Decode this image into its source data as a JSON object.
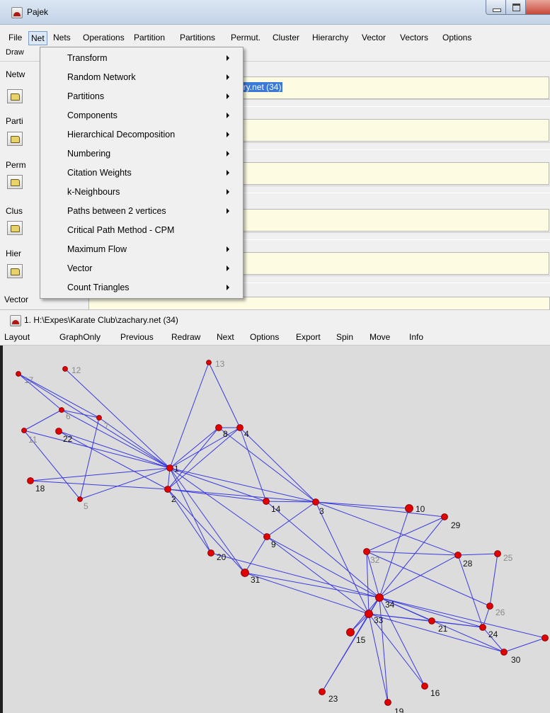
{
  "window": {
    "title": "Pajek",
    "menu": [
      "File",
      "Net",
      "Nets",
      "Operations",
      "Partition",
      "Partitions",
      "Permut.",
      "Cluster",
      "Hierarchy",
      "Vector",
      "Vectors",
      "Options"
    ],
    "draw_label": "Draw",
    "sections": [
      "Netw",
      "Parti",
      "Perm",
      "Clus",
      "Hier",
      "Vector"
    ],
    "network_field_text": "ary.net (34)"
  },
  "net_menu": {
    "items": [
      {
        "label": "Transform",
        "submenu": true
      },
      {
        "label": "Random Network",
        "submenu": true
      },
      {
        "label": "Partitions",
        "submenu": true
      },
      {
        "label": "Components",
        "submenu": true
      },
      {
        "label": "Hierarchical Decomposition",
        "submenu": true
      },
      {
        "label": "Numbering",
        "submenu": true
      },
      {
        "label": "Citation Weights",
        "submenu": true
      },
      {
        "label": "k-Neighbours",
        "submenu": true
      },
      {
        "label": "Paths between 2 vertices",
        "submenu": true
      },
      {
        "label": "Critical Path Method - CPM",
        "submenu": false
      },
      {
        "label": "Maximum Flow",
        "submenu": true
      },
      {
        "label": "Vector",
        "submenu": true
      },
      {
        "label": "Count Triangles",
        "submenu": true
      }
    ]
  },
  "graph_window": {
    "title": "1. H:\\Expes\\Karate Club\\zachary.net (34)",
    "menu": [
      "Layout",
      "GraphOnly",
      "Previous",
      "Redraw",
      "Next",
      "Options",
      "Export",
      "Spin",
      "Move",
      "Info"
    ]
  },
  "colors": {
    "edge": "#3a3ae0",
    "vertex_fill": "#e00000",
    "label": "#111111",
    "label_faint": "#8a8a8a",
    "selection": "#3b78d8"
  },
  "graph": {
    "vertices": [
      "1",
      "2",
      "3",
      "4",
      "5",
      "6",
      "7",
      "8",
      "9",
      "10",
      "11",
      "12",
      "13",
      "14",
      "15",
      "16",
      "17",
      "18",
      "19",
      "20",
      "21",
      "22",
      "23",
      "24",
      "25",
      "26",
      "28",
      "29",
      "30",
      "31",
      "32",
      "33",
      "34"
    ],
    "faint_labels": [
      "5",
      "6",
      "7",
      "11",
      "12",
      "13",
      "17",
      "25",
      "26",
      "32"
    ]
  }
}
